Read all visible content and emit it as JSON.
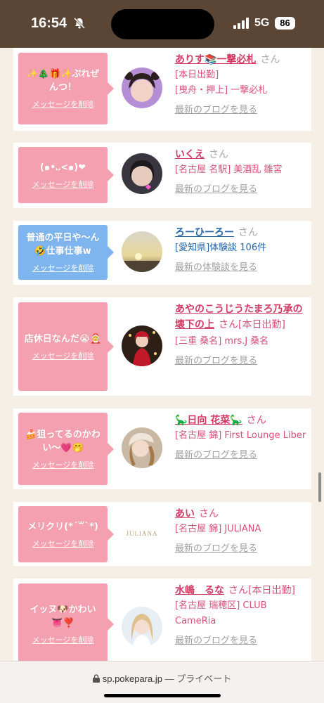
{
  "status": {
    "time": "16:54",
    "network": "5G",
    "battery": "86"
  },
  "cards": [
    {
      "message": "✨🎄🎁✨ぷれぜんつ！",
      "delete_label": "メッセージを削除",
      "name": "ありす📚一撃必札",
      "suffix": "さん",
      "tags": [
        "[本日出勤]",
        "[曳舟・押上] 一撃必札"
      ],
      "link": "最新のブログを見る"
    },
    {
      "message": "(๑•᎑<๑)❤︎",
      "delete_label": "メッセージを削除",
      "name": "いくえ",
      "suffix": "さん",
      "tags": [
        "[名古屋 名駅] 美酒乱 雛宮"
      ],
      "link": "最新のブログを見る"
    },
    {
      "message": "普通の平日や〜ん🤣仕事仕事w",
      "delete_label": "メッセージを削除",
      "name": "ろーひーろー",
      "suffix": "さん",
      "tags": [
        "[愛知県]体験談 106件"
      ],
      "link": "最新の体験談を見る"
    },
    {
      "message": "店休日なんだ😭🤶",
      "delete_label": "メッセージを削除",
      "name": "あやのこうじうたまろ乃承の壊下の上",
      "suffix": "さん[本日出勤]",
      "tags": [
        "[三重 桑名] mrs.J 桑名"
      ],
      "link": "最新のブログを見る"
    },
    {
      "message": "🍰狙ってるのかわい〜💗🤭",
      "delete_label": "メッセージを削除",
      "name": "🦕日向 花菜🦕",
      "suffix": "さん",
      "tags": [
        "[名古屋 錦] First Lounge Liber"
      ],
      "link": "最新のブログを見る"
    },
    {
      "message": "メリクリ(*´꒳`*)",
      "delete_label": "メッセージを削除",
      "name": "あい",
      "suffix": "さん",
      "tags": [
        "[名古屋 錦] JULIANA"
      ],
      "link": "最新のブログを見る",
      "logo_text": "JULIANA"
    },
    {
      "message": "イッヌ🐶かわい👅❣️",
      "delete_label": "メッセージを削除",
      "name": "水嶋　るな",
      "suffix": "さん[本日出勤]",
      "tags": [
        "[名古屋 瑞穂区] CLUB CameRia"
      ],
      "link": "最新のブログを見る"
    }
  ],
  "browser": {
    "url": "sp.pokepara.jp",
    "mode": "— プライベート"
  }
}
